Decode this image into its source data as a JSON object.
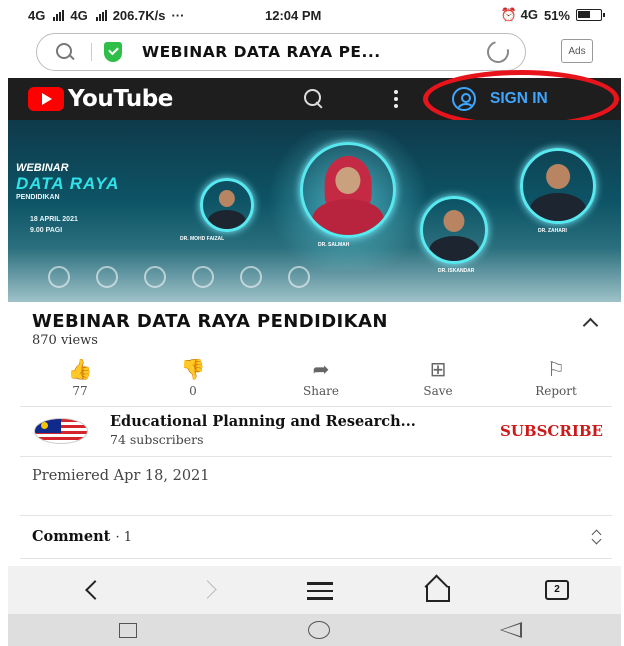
{
  "status_bar": {
    "network_1": "4G",
    "network_2": "4G",
    "speed": "206.7K/s",
    "dots": "···",
    "time": "12:04 PM",
    "alarm_network": "⏰ 4G",
    "battery": "51%"
  },
  "browser": {
    "url_title": "WEBINAR DATA RAYA PE...",
    "ads_label": "Ads"
  },
  "youtube": {
    "logo_text": "YouTube",
    "sign_in_label": "SIGN IN"
  },
  "video": {
    "thumbnail_heading": "WEBINAR",
    "thumbnail_title": "DATA RAYA",
    "thumbnail_subtitle": "PENDIDIKAN",
    "thumbnail_date": "18 APRIL 2021",
    "thumbnail_time": "9.00 PAGI",
    "speaker_1": "DR. MOHD FAIZAL",
    "speaker_2": "DR. SALMAH",
    "speaker_3": "DR. ZAHARI",
    "speaker_4": "DR. ISKANDAR"
  },
  "details": {
    "title": "WEBINAR DATA RAYA PENDIDIKAN",
    "views": "870 views"
  },
  "actions": [
    {
      "icon": "thumbs-up-icon",
      "glyph": "👍",
      "label": "77"
    },
    {
      "icon": "thumbs-down-icon",
      "glyph": "👎",
      "label": "0"
    },
    {
      "icon": "share-icon",
      "glyph": "➦",
      "label": "Share"
    },
    {
      "icon": "save-icon",
      "glyph": "⊞",
      "label": "Save"
    },
    {
      "icon": "flag-icon",
      "glyph": "⚐",
      "label": "Report"
    }
  ],
  "channel": {
    "name": "Educational Planning and Research...",
    "subscribers": "74 subscribers",
    "subscribe_label": "SUBSCRIBE"
  },
  "premiered": "Premiered Apr 18, 2021",
  "comments": {
    "label": "Comment",
    "count": "· 1"
  },
  "browser_nav": {
    "tabs_count": "2"
  },
  "colors": {
    "youtube_red": "#ff0000",
    "sign_in_blue": "#3ea6ff",
    "subscribe_red": "#cc1a1a",
    "annotation_circle": "#e8141b"
  }
}
